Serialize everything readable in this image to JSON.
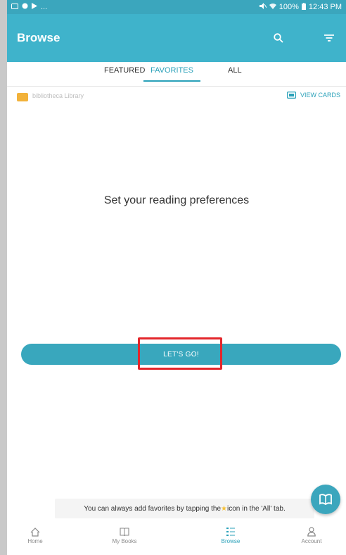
{
  "status_bar": {
    "left_icons": [
      "notification-icon",
      "vpn-icon",
      "play-icon"
    ],
    "left_more": "...",
    "battery": "100%",
    "time": "12:43 PM"
  },
  "app_bar": {
    "title": "Browse"
  },
  "tabs": [
    {
      "label": "FEATURED",
      "active": false
    },
    {
      "label": "FAVORITES",
      "active": true
    },
    {
      "label": "ALL",
      "active": false
    }
  ],
  "library": {
    "name": "bibliotheca Library",
    "view_cards_label": "VIEW CARDS"
  },
  "main": {
    "headline": "Set your reading preferences",
    "cta_label": "LET'S GO!"
  },
  "toast": {
    "before_star": "You can always add favorites by tapping the ",
    "after_star": " icon in the 'All' tab."
  },
  "bottom_nav": [
    {
      "label": "Home",
      "icon": "home-icon",
      "active": false
    },
    {
      "label": "My Books",
      "icon": "book-icon",
      "active": false
    },
    {
      "label": "Browse",
      "icon": "browse-icon",
      "active": true
    },
    {
      "label": "Account",
      "icon": "account-icon",
      "active": false
    }
  ],
  "colors": {
    "accent": "#3fb3cb",
    "highlight_box": "#e3262b",
    "star": "#f7c23a"
  }
}
